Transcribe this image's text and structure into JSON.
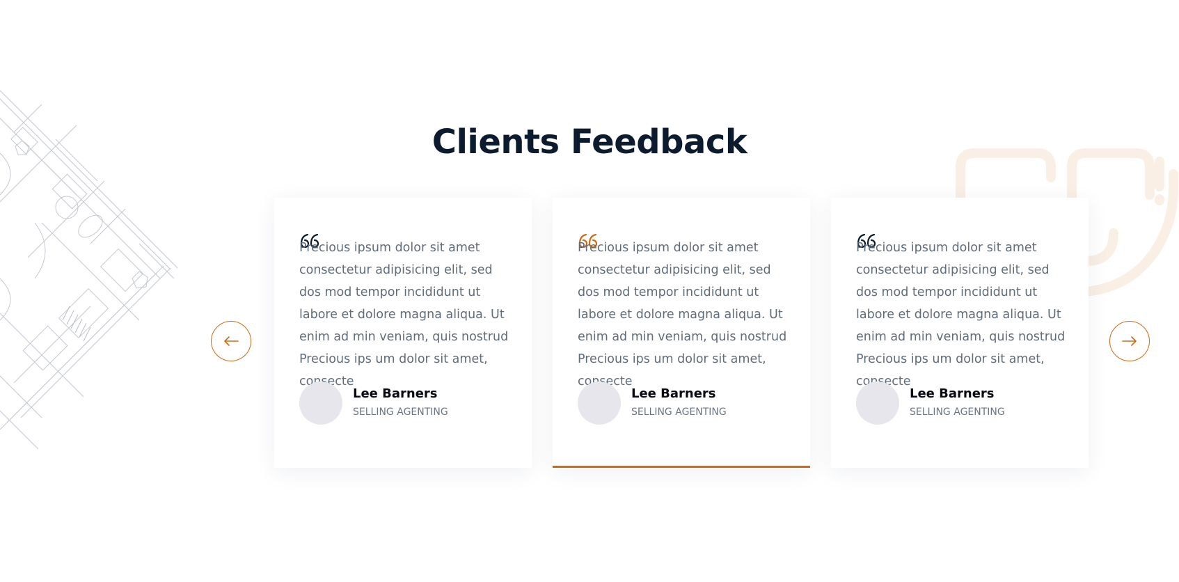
{
  "section": {
    "title": "Clients Feedback"
  },
  "colors": {
    "accent": "#d06a12",
    "heading": "#0d1b2e",
    "body_text": "#5f6c7b",
    "quote_default": "#0d1b2e",
    "quote_active": "#d06a12"
  },
  "navigation": {
    "prev_icon": "arrow-left-icon",
    "next_icon": "arrow-right-icon"
  },
  "testimonials": [
    {
      "quote_icon": "quote-icon",
      "text": "Precious ipsum dolor sit amet consectetur adipisicing elit, sed dos mod tempor incididunt ut labore et dolore magna aliqua. Ut enim ad min veniam, quis nostrud Precious ips um dolor sit amet, consecte",
      "author": "Lee Barners",
      "role": "SELLING AGENTING",
      "active": false
    },
    {
      "quote_icon": "quote-icon",
      "text": "Precious ipsum dolor sit amet consectetur adipisicing elit, sed dos mod tempor incididunt ut labore et dolore magna aliqua. Ut enim ad min veniam, quis nostrud Precious ips um dolor sit amet, consecte",
      "author": "Lee Barners",
      "role": "SELLING AGENTING",
      "active": true
    },
    {
      "quote_icon": "quote-icon",
      "text": "Precious ipsum dolor sit amet consectetur adipisicing elit, sed dos mod tempor incididunt ut labore et dolore magna aliqua. Ut enim ad min veniam, quis nostrud Precious ips um dolor sit amet, consecte",
      "author": "Lee Barners",
      "role": "SELLING AGENTING",
      "active": false
    }
  ]
}
